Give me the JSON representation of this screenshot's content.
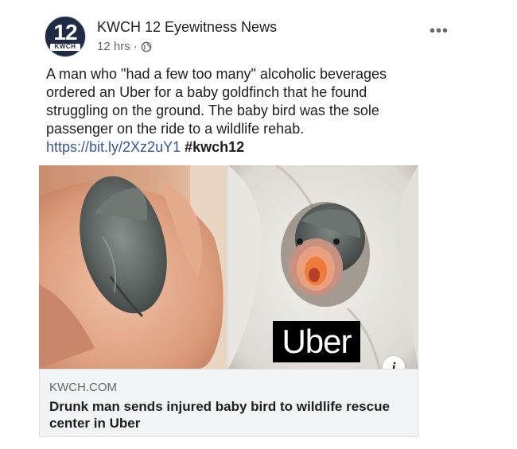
{
  "post": {
    "page_name": "KWCH 12 Eyewitness News",
    "timestamp": "12 hrs",
    "separator": "·",
    "privacy_icon": "globe-icon",
    "more_icon": "ellipsis-icon",
    "more_label": "•••",
    "logo": {
      "number": "12",
      "call_sign": "KWCH"
    },
    "body": {
      "text": "A man who \"had a few too many\" alcoholic beverages ordered an Uber for a baby goldfinch that he found struggling on the ground. The baby bird was the sole passenger on the ride to a wildlife rehab. ",
      "link": "https://bit.ly/2Xz2uY1",
      "hashtag": "#kwch12"
    },
    "media": {
      "left_image": "hand-holding-baby-bird",
      "right_image": "baby-bird-in-towel",
      "overlay_label": "Uber",
      "info_label": "i"
    },
    "link_card": {
      "domain": "KWCH.COM",
      "headline": "Drunk man sends injured baby bird to wildlife rescue center in Uber"
    }
  },
  "colors": {
    "link": "#385898",
    "meta": "#606770",
    "card_bg": "#f2f3f5"
  }
}
